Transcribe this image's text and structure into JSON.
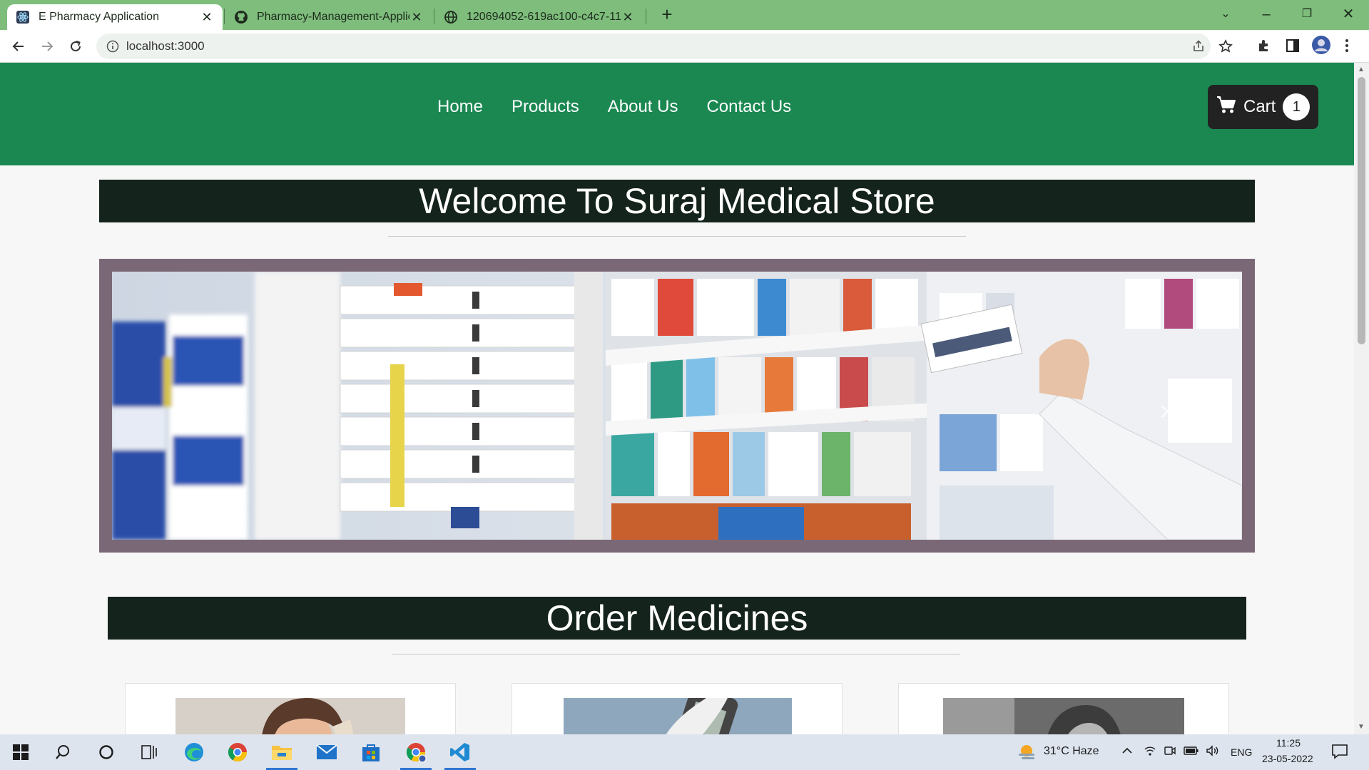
{
  "browser": {
    "tabs": [
      {
        "title": "E Pharmacy Application",
        "active": true
      },
      {
        "title": "Pharmacy-Management-Applicat",
        "active": false
      },
      {
        "title": "120694052-619ac100-c4c7-11eb",
        "active": false
      }
    ],
    "url": "localhost:3000",
    "accent_color": "#7ebd7c"
  },
  "site": {
    "nav_links": [
      "Home",
      "Products",
      "About Us",
      "Contact Us"
    ],
    "cart_label": "Cart",
    "cart_count": "1",
    "welcome_title": "Welcome To Suraj Medical Store",
    "order_title": "Order Medicines",
    "nav_color": "#1b8852",
    "banner_color": "#14231c"
  },
  "taskbar": {
    "weather": "31°C  Haze",
    "language": "ENG",
    "time": "11:25",
    "date": "23-05-2022"
  }
}
